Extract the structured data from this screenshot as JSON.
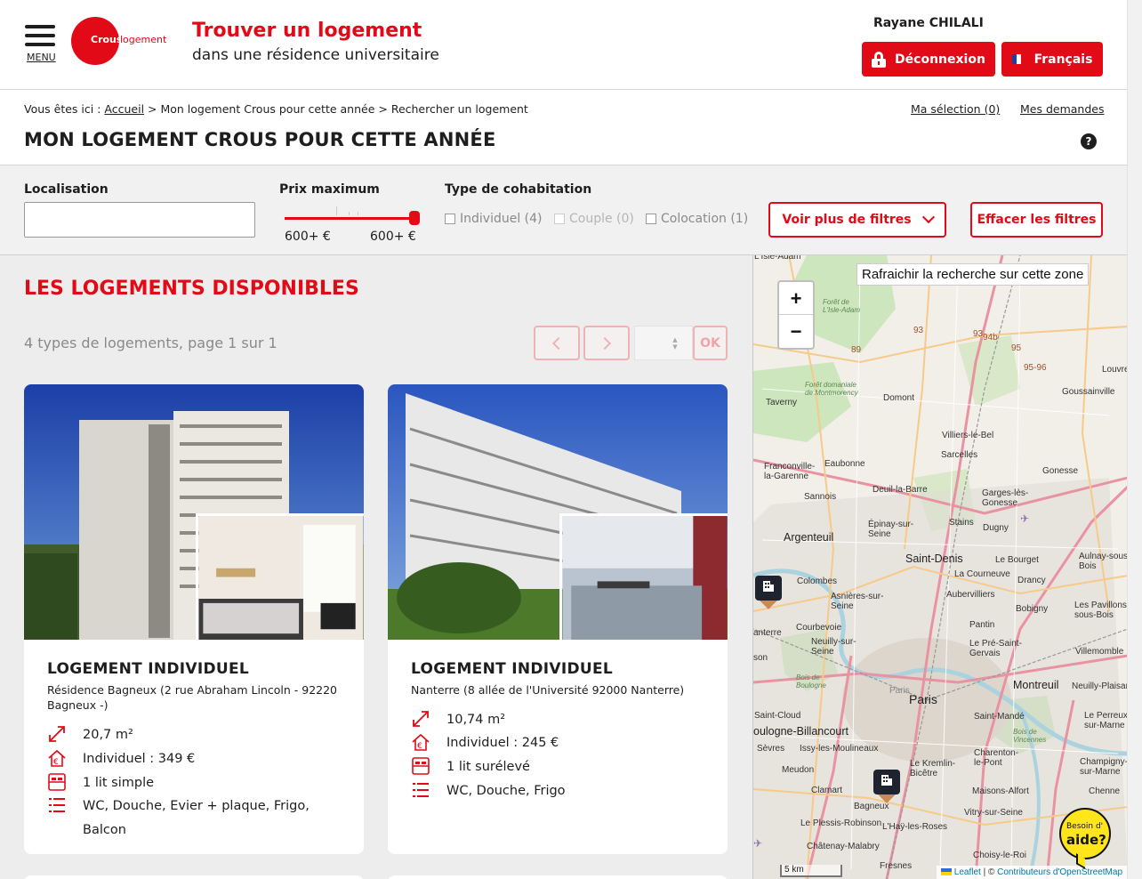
{
  "header": {
    "menu_label": "MENU",
    "logo_text_1": "Crous",
    "logo_text_2": "logement",
    "title": "Trouver un logement",
    "subtitle": "dans une résidence universitaire",
    "user_name": "Rayane CHILALI",
    "logout_label": "Déconnexion",
    "language_label": "Français",
    "colors": {
      "brand": "#e20a16"
    }
  },
  "breadcrumb": {
    "prefix": "Vous êtes ici :",
    "home": "Accueil",
    "rest": "> Mon logement Crous pour cette année > Rechercher un logement"
  },
  "top_links": {
    "selection": "Ma sélection (0)",
    "requests": "Mes demandes"
  },
  "page_title": "MON LOGEMENT CROUS POUR CETTE ANNÉE",
  "help_icon_glyph": "?",
  "filters": {
    "location_label": "Localisation",
    "location_value": "",
    "price_label": "Prix maximum",
    "price_min_value": "600+ €",
    "price_max_value": "600+ €",
    "price_slider_level": 1.0,
    "cohab_label": "Type de cohabitation",
    "cohab_options": [
      {
        "label": "Individuel (4)",
        "checked": false,
        "enabled": true
      },
      {
        "label": "Couple (0)",
        "checked": false,
        "enabled": false
      },
      {
        "label": "Colocation (1)",
        "checked": false,
        "enabled": true
      }
    ],
    "more_filters_label": "Voir plus de filtres",
    "clear_filters_label": "Effacer les filtres"
  },
  "results": {
    "title": "LES LOGEMENTS DISPONIBLES",
    "count_text": "4 types de logements, page 1 sur 1",
    "page_input_value": "",
    "ok_label": "OK",
    "cards": [
      {
        "title": "LOGEMENT INDIVIDUEL",
        "address": "Résidence Bagneux (2 rue Abraham Lincoln - 92220 Bagneux -)",
        "surface": "20,7 m²",
        "price": "Individuel : 349 €",
        "bed": "1 lit simple",
        "equipment": "WC, Douche, Evier + plaque, Frigo, Balcon"
      },
      {
        "title": "LOGEMENT INDIVIDUEL",
        "address": "Nanterre (8 allée de l'Université 92000 Nanterre)",
        "surface": "10,74 m²",
        "price": "Individuel : 245 €",
        "bed": "1 lit surélevé",
        "equipment": "WC, Douche, Frigo"
      }
    ]
  },
  "map": {
    "refresh_label": "Rafraichir la recherche sur cette zone",
    "zoom_in": "+",
    "zoom_out": "−",
    "scale_label": "5 km",
    "attribution_leaflet": "Leaflet",
    "attribution_sep": "| ©",
    "attribution_osm": "Contributeurs d'OpenStreetMap",
    "help_line1": "Besoin d'",
    "help_line2": "aide?",
    "places": [
      "Taverny",
      "Domont",
      "Louvres",
      "Goussainville",
      "Villiers-le-Bel",
      "Sarcelles",
      "Franconville-la-Garenne",
      "Eaubonne",
      "Deuil-la-Barre",
      "Gonesse",
      "Garges-lès-Gonesse",
      "Sannois",
      "Argenteuil",
      "Épinay-sur-Seine",
      "Stains",
      "Dugny",
      "Saint-Denis",
      "Le Bourget",
      "Aulnay-sous-Bois",
      "Colombes",
      "La Courneuve",
      "Drancy",
      "Asnières-sur-Seine",
      "Aubervilliers",
      "Bobigny",
      "Les Pavillons-sous-Bois",
      "Courbevoie",
      "Pantin",
      "Neuilly-sur-Seine",
      "Le Pré-Saint-Gervais",
      "Villemomble",
      "Paris",
      "Montreuil",
      "Neuilly-Plaisance",
      "Saint-Cloud",
      "Saint-Mandé",
      "Boulogne-Billancourt",
      "Le Perreux-sur-Marne",
      "Sèvres",
      "Issy-les-Moulineaux",
      "Charenton-le-Pont",
      "Meudon",
      "Le Kremlin-Bicêtre",
      "Champigny-sur-Marne",
      "Clamart",
      "Maisons-Alfort",
      "Bagneux",
      "Vitry-sur-Seine",
      "Le Plessis-Robinson",
      "L'Haÿ-les-Roses",
      "Châtenay-Malabry",
      "Choisy-le-Roi",
      "Fresnes",
      "Forêt de L'Isle-Adam",
      "Forêt domaniale de Montmorency",
      "Bois de Boulogne",
      "Bois de Vincennes"
    ],
    "road_numbers": [
      "93",
      "94b",
      "95",
      "95-96",
      "89"
    ]
  }
}
